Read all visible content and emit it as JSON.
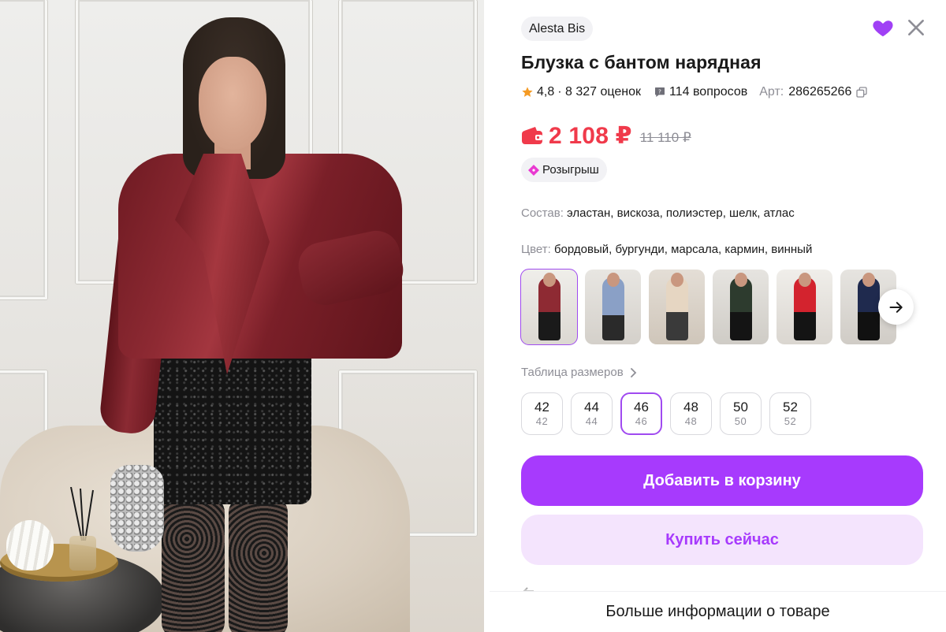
{
  "product": {
    "seller": "Alesta Bis",
    "title": "Блузка с бантом нарядная",
    "rating": "4,8",
    "reviews": "· 8 327 оценок",
    "questions": "114 вопросов",
    "article_label": "Арт:",
    "article": "286265266",
    "price": "2 108 ₽",
    "old_price": "11 110 ₽",
    "promo": "Розыгрыш",
    "composition_label": "Состав:",
    "composition": "эластан, вискоза, полиэстер, шелк, атлас",
    "color_label": "Цвет:",
    "color": "бордовый, бургунди, марсала, кармин, винный"
  },
  "gallery": {
    "thumbnails": [
      {
        "name": "thumb-burgundy",
        "selected": true
      },
      {
        "name": "thumb-blue",
        "selected": false
      },
      {
        "name": "thumb-beige",
        "selected": false
      },
      {
        "name": "thumb-green-print",
        "selected": false
      },
      {
        "name": "thumb-red",
        "selected": false
      },
      {
        "name": "thumb-navy-print",
        "selected": false
      }
    ]
  },
  "sizes": {
    "link_label": "Таблица размеров",
    "options": [
      {
        "main": "42",
        "sub": "42",
        "selected": false
      },
      {
        "main": "44",
        "sub": "44",
        "selected": false
      },
      {
        "main": "46",
        "sub": "46",
        "selected": true
      },
      {
        "main": "48",
        "sub": "48",
        "selected": false
      },
      {
        "main": "50",
        "sub": "50",
        "selected": false
      },
      {
        "main": "52",
        "sub": "52",
        "selected": false
      }
    ]
  },
  "actions": {
    "add_to_cart": "Добавить в корзину",
    "buy_now": "Купить сейчас",
    "more_info": "Больше информации о товаре"
  },
  "colors": {
    "accent": "#a73afd",
    "accent_light": "#f4e4fd",
    "price_red": "#f03a4b",
    "muted_text": "#8e8e96",
    "pill_bg": "#f2f2f5"
  },
  "icons": {
    "favorite": "heart-icon",
    "close": "close-icon",
    "rating": "star-icon",
    "questions": "question-bubble-icon",
    "copy": "copy-icon",
    "wallet": "wallet-icon",
    "promo": "tag-icon",
    "next": "arrow-right-icon",
    "chevron": "chevron-right-icon"
  }
}
